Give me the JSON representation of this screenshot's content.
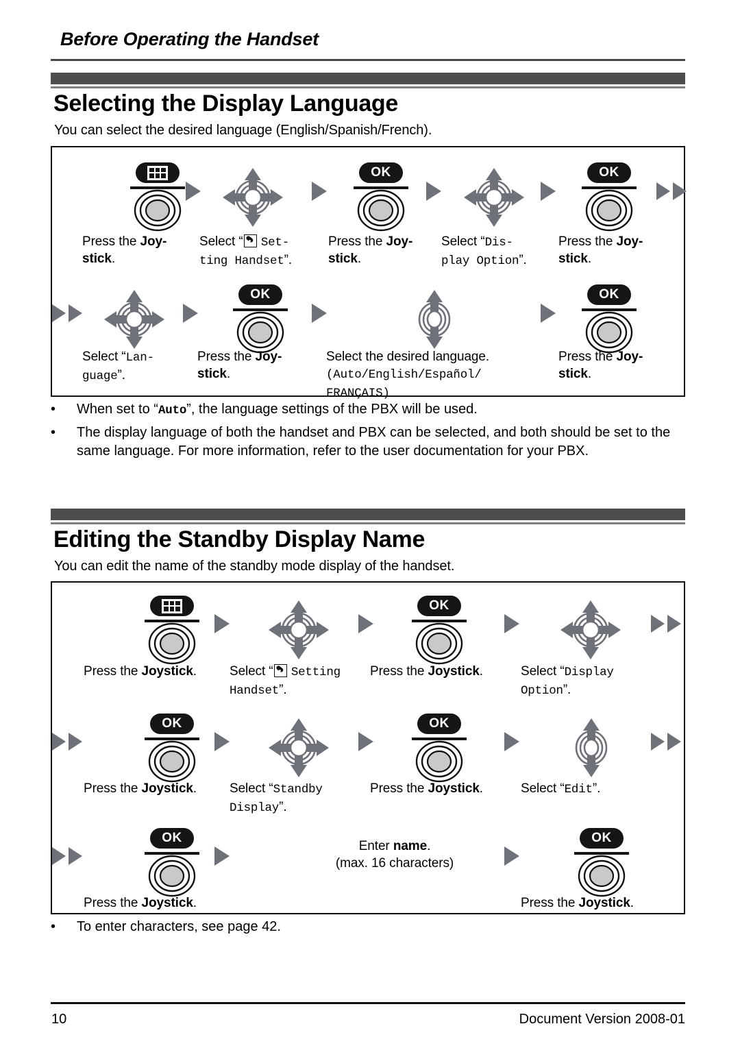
{
  "header": {
    "running_title": "Before Operating the Handset"
  },
  "footer": {
    "page_number": "10",
    "document_version": "Document Version 2008-01"
  },
  "colors": {
    "banner_bar": "#4d4d4d",
    "banner_underline": "#808080",
    "arrow_gray": "#6e7177",
    "key_black": "#151515",
    "rule_dark": "#4a4a4a"
  },
  "icons": {
    "menu_key": "menu-grid-key-icon",
    "ok_key": "ok-key-icon",
    "joystick_4way": "joystick-4way-icon",
    "joystick_updown": "joystick-up-down-icon",
    "arrow": "play-triangle-arrow-icon",
    "arrow_double": "double-triangle-arrow-icon",
    "handset_setting": "handset-setting-icon",
    "ok_label": "OK"
  },
  "sections": [
    {
      "id": "selecting-display-language",
      "title": "Selecting the Display Language",
      "intro": "You can select the desired language (English/Spanish/French).",
      "steps_row1": [
        {
          "icon": "menu-key",
          "caption_html": "Press the <b>Joy-<br>stick</b>."
        },
        {
          "icon": "joystick-4way",
          "caption_html": "Select &ldquo;<span class=\"hs-icon\"></span> <span class=\"mono\">Set-<br>ting Handset</span>&rdquo;."
        },
        {
          "icon": "ok-key",
          "caption_html": "Press the <b>Joy-<br>stick</b>."
        },
        {
          "icon": "joystick-4way",
          "caption_html": "Select &ldquo;<span class=\"mono\">Dis-<br>play Option</span>&rdquo;."
        },
        {
          "icon": "ok-key",
          "caption_html": "Press the <b>Joy-<br>stick</b>."
        }
      ],
      "steps_row2": [
        {
          "icon": "joystick-4way",
          "caption_html": "Select &ldquo;<span class=\"mono\">Lan-<br>guage</span>&rdquo;."
        },
        {
          "icon": "ok-key",
          "caption_html": "Press the <b>Joy-<br>stick</b>."
        },
        {
          "icon": "joystick-updown",
          "caption_html": "Select the desired language.<br><span class=\"mono\">(Auto/English/Espa&ntilde;ol/<br>FRAN&Ccedil;AIS)</span>"
        },
        {
          "icon": "ok-key",
          "caption_html": "Press the <b>Joy-<br>stick</b>."
        }
      ],
      "notes": [
        "When set to &ldquo;<span class=\"mono\" style=\"font-weight:bold\">Auto</span>&rdquo;, the language settings of the PBX will be used.",
        "The display language of both the handset and PBX can be selected, and both should be set to the same language. For more information, refer to the user documentation for your PBX."
      ]
    },
    {
      "id": "editing-standby-display-name",
      "title": "Editing the Standby Display Name",
      "intro": "You can edit the name of the standby mode display of the handset.",
      "steps_row1": [
        {
          "icon": "menu-key",
          "caption_html": "Press the <b>Joystick</b>."
        },
        {
          "icon": "joystick-4way",
          "caption_html": "Select &ldquo;<span class=\"hs-icon\"></span> <span class=\"mono\">Setting<br>Handset</span>&rdquo;."
        },
        {
          "icon": "ok-key",
          "caption_html": "Press the <b>Joystick</b>."
        },
        {
          "icon": "joystick-4way",
          "caption_html": "Select &ldquo;<span class=\"mono\">Display<br>Option</span>&rdquo;."
        }
      ],
      "steps_row2": [
        {
          "icon": "ok-key",
          "caption_html": "Press the <b>Joystick</b>."
        },
        {
          "icon": "joystick-4way",
          "caption_html": "Select &ldquo;<span class=\"mono\">Standby<br>Display</span>&rdquo;."
        },
        {
          "icon": "ok-key",
          "caption_html": "Press the <b>Joystick</b>."
        },
        {
          "icon": "joystick-updown",
          "caption_html": "Select &ldquo;<span class=\"mono\">Edit</span>&rdquo;."
        }
      ],
      "steps_row3": [
        {
          "icon": "ok-key",
          "caption_html": "Press the <b>Joystick</b>."
        },
        {
          "icon": "text-only",
          "caption_html": "Enter <b>name</b>.<br>(max. 16 characters)"
        },
        {
          "icon": "ok-key",
          "caption_html": "Press the <b>Joystick</b>."
        }
      ],
      "notes": [
        "To enter characters, see page 42."
      ]
    }
  ]
}
